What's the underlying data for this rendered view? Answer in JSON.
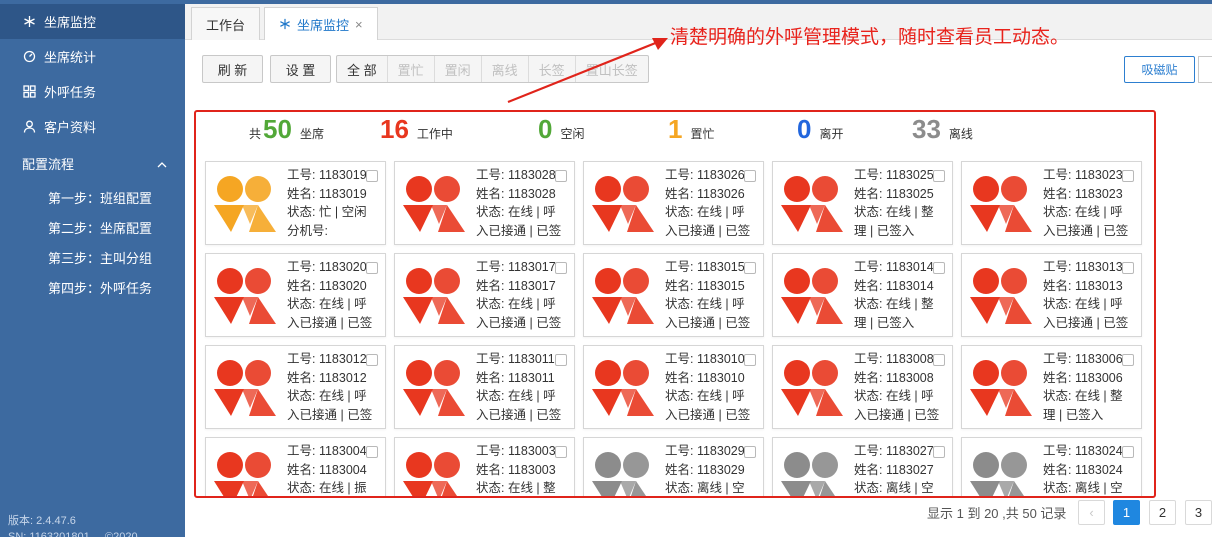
{
  "sidebar": {
    "items": [
      {
        "label": "坐席监控",
        "icon": "snowflake-icon"
      },
      {
        "label": "坐席统计",
        "icon": "gauge-icon"
      },
      {
        "label": "外呼任务",
        "icon": "grid-icon"
      },
      {
        "label": "客户资料",
        "icon": "user-icon"
      }
    ],
    "group": {
      "label": "配置流程",
      "expanded": true
    },
    "sub": [
      "第一步：班组配置",
      "第二步：坐席配置",
      "第三步：主叫分组",
      "第四步：外呼任务"
    ],
    "version": "版本: 2.4.47.6",
    "sn": "SN: 1163201801     ©2020"
  },
  "tabs": [
    {
      "label": "工作台"
    },
    {
      "label": "坐席监控",
      "close": "×"
    }
  ],
  "toolbar": {
    "refresh": "刷 新",
    "settings": "设 置",
    "filters": [
      "全 部",
      "置忙",
      "置闲",
      "离线",
      "长签",
      "置山长签"
    ],
    "right_button": "吸磁贴"
  },
  "annotation": "清楚明确的外呼管理模式，随时查看员工动态。",
  "colors": {
    "working": "#e8371f",
    "idle": "#f5a623",
    "offline": "#8c8c8c",
    "accent": "#e0241b",
    "total": "#52a838",
    "away": "#2266dd",
    "busy": "#f5a623",
    "idle_num": "#52a838"
  },
  "stats": [
    {
      "pre": "共",
      "num": "50",
      "label": "坐席"
    },
    {
      "num": "16",
      "label": "工作中"
    },
    {
      "num": "0",
      "label": "空闲"
    },
    {
      "num": "1",
      "label": "置忙"
    },
    {
      "num": "0",
      "label": "离开"
    },
    {
      "num": "33",
      "label": "离线"
    }
  ],
  "agents": [
    {
      "id": "工号: 1183019",
      "name": "姓名: 1183019",
      "s1": "状态: 忙 | 空闲",
      "s2": "分机号:",
      "status": "busy"
    },
    {
      "id": "工号: 1183028",
      "name": "姓名: 1183028",
      "s1": "状态: 在线 | 呼",
      "s2": "入已接通 | 已签",
      "status": "working"
    },
    {
      "id": "工号: 1183026",
      "name": "姓名: 1183026",
      "s1": "状态: 在线 | 呼",
      "s2": "入已接通 | 已签",
      "status": "working"
    },
    {
      "id": "工号: 1183025",
      "name": "姓名: 1183025",
      "s1": "状态: 在线 | 整",
      "s2": "理 | 已签入",
      "status": "working"
    },
    {
      "id": "工号: 1183023",
      "name": "姓名: 1183023",
      "s1": "状态: 在线 | 呼",
      "s2": "入已接通 | 已签",
      "status": "working"
    },
    {
      "id": "工号: 1183020",
      "name": "姓名: 1183020",
      "s1": "状态: 在线 | 呼",
      "s2": "入已接通 | 已签",
      "status": "working"
    },
    {
      "id": "工号: 1183017",
      "name": "姓名: 1183017",
      "s1": "状态: 在线 | 呼",
      "s2": "入已接通 | 已签",
      "status": "working"
    },
    {
      "id": "工号: 1183015",
      "name": "姓名: 1183015",
      "s1": "状态: 在线 | 呼",
      "s2": "入已接通 | 已签",
      "status": "working"
    },
    {
      "id": "工号: 1183014",
      "name": "姓名: 1183014",
      "s1": "状态: 在线 | 整",
      "s2": "理 | 已签入",
      "status": "working"
    },
    {
      "id": "工号: 1183013",
      "name": "姓名: 1183013",
      "s1": "状态: 在线 | 呼",
      "s2": "入已接通 | 已签",
      "status": "working"
    },
    {
      "id": "工号: 1183012",
      "name": "姓名: 1183012",
      "s1": "状态: 在线 | 呼",
      "s2": "入已接通 | 已签",
      "status": "working"
    },
    {
      "id": "工号: 1183011",
      "name": "姓名: 1183011",
      "s1": "状态: 在线 | 呼",
      "s2": "入已接通 | 已签",
      "status": "working"
    },
    {
      "id": "工号: 1183010",
      "name": "姓名: 1183010",
      "s1": "状态: 在线 | 呼",
      "s2": "入已接通 | 已签",
      "status": "working"
    },
    {
      "id": "工号: 1183008",
      "name": "姓名: 1183008",
      "s1": "状态: 在线 | 呼",
      "s2": "入已接通 | 已签",
      "status": "working"
    },
    {
      "id": "工号: 1183006",
      "name": "姓名: 1183006",
      "s1": "状态: 在线 | 整",
      "s2": "理 | 已签入",
      "status": "working"
    },
    {
      "id": "工号: 1183004",
      "name": "姓名: 1183004",
      "s1": "状态: 在线 | 振",
      "s2": "",
      "status": "working"
    },
    {
      "id": "工号: 1183003",
      "name": "姓名: 1183003",
      "s1": "状态: 在线 | 整",
      "s2": "",
      "status": "working"
    },
    {
      "id": "工号: 1183029",
      "name": "姓名: 1183029",
      "s1": "状态: 离线 | 空",
      "s2": "",
      "status": "offline"
    },
    {
      "id": "工号: 1183027",
      "name": "姓名: 1183027",
      "s1": "状态: 离线 | 空",
      "s2": "",
      "status": "offline"
    },
    {
      "id": "工号: 1183024",
      "name": "姓名: 1183024",
      "s1": "状态: 离线 | 空",
      "s2": "",
      "status": "offline"
    }
  ],
  "pagination": {
    "summary": "显示 1 到 20 ,共 50 记录",
    "prev": "‹",
    "pages": [
      "1",
      "2",
      "3"
    ],
    "current": "1"
  }
}
